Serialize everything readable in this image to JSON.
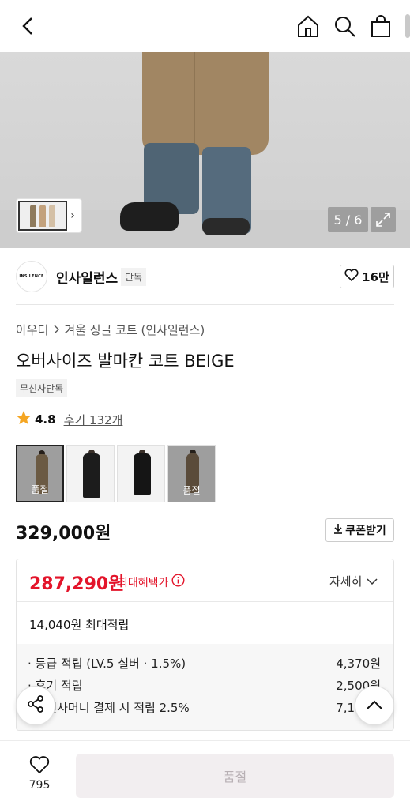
{
  "hero": {
    "pager_text": "5 / 6"
  },
  "brand": {
    "logo_text": "INSILENCE",
    "name": "인사일런스",
    "tag": "단독",
    "likes": "16만"
  },
  "breadcrumb": {
    "level1": "아우터",
    "level2": "겨울 싱글 코트 (인사일런스)"
  },
  "product": {
    "title": "오버사이즈 발마칸 코트 BEIGE",
    "exclusive_tag": "무신사단독",
    "rating": "4.8",
    "review_label": "후기 132개",
    "price": "329,000원",
    "coupon_label": "쿠폰받기"
  },
  "variants": [
    {
      "soldout_label": "품절",
      "color": "#a58b67"
    },
    {
      "soldout_label": "",
      "color": "#1c1c1c"
    },
    {
      "soldout_label": "",
      "color": "#151515"
    },
    {
      "soldout_label": "품절",
      "color": "#8a7459"
    }
  ],
  "benefit": {
    "max_price": "287,290원",
    "max_label": "최대혜택가",
    "detail_label": "자세히",
    "points_total": "14,040원 최대적립",
    "rows": [
      {
        "label": "· 등급 적립 (LV.5 실버 · 1.5%)",
        "value": "4,370원"
      },
      {
        "label": "· 후기 적립",
        "value": "2,500원"
      },
      {
        "label": "· 무신사머니 결제 시 적립 2.5%",
        "value": "7,170원"
      }
    ]
  },
  "bottom": {
    "wish_count": "795",
    "buy_label": "품절"
  },
  "colors": {
    "accent_red": "#e3142a",
    "disabled_button_bg": "#f2eef0"
  }
}
